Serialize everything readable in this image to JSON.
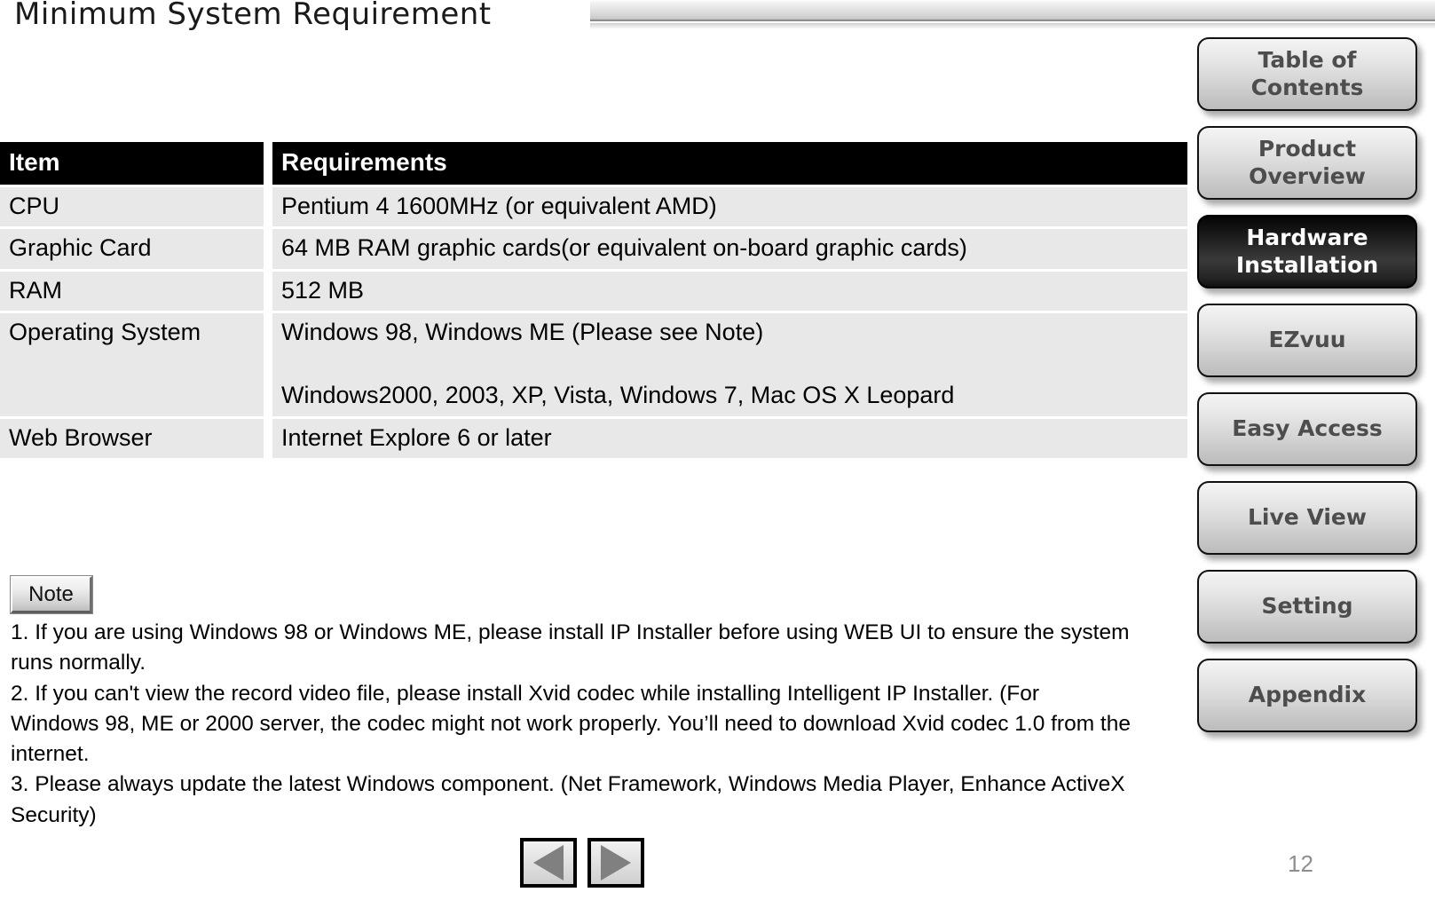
{
  "page_title": "Minimum System Requirement",
  "table": {
    "headers": [
      "Item",
      "Requirements"
    ],
    "rows": [
      {
        "item": "CPU",
        "requirement": "Pentium 4 1600MHz (or equivalent AMD)",
        "requirement2": ""
      },
      {
        "item": "Graphic Card",
        "requirement": "64 MB RAM graphic cards(or equivalent on-board graphic cards)",
        "requirement2": ""
      },
      {
        "item": "RAM",
        "requirement": "512 MB",
        "requirement2": ""
      },
      {
        "item": "Operating System",
        "requirement": "Windows 98, Windows ME (Please see Note)",
        "requirement2": "Windows2000, 2003, XP, Vista, Windows 7, Mac OS X Leopard"
      },
      {
        "item": "Web Browser",
        "requirement": "Internet Explore 6 or later",
        "requirement2": ""
      }
    ]
  },
  "note": {
    "badge_label": "Note",
    "items": [
      "1. If you are using Windows 98 or Windows ME, please install IP Installer before using WEB UI to ensure the system runs normally.",
      "2. If you can't view the record video file, please install Xvid codec while installing Intelligent IP Installer. (For Windows 98, ME or 2000 server, the codec might not work properly. You’ll need to download Xvid codec 1.0 from the internet.",
      "3. Please always update the latest Windows component. (Net Framework, Windows Media Player, Enhance ActiveX Security)"
    ]
  },
  "navigation": {
    "prev_label": "◀",
    "next_label": "▶",
    "prev_icon": "triangle-left-icon",
    "next_icon": "triangle-right-icon"
  },
  "sidebar": {
    "items": [
      {
        "label": "Table of Contents",
        "active": false
      },
      {
        "label": "Product Overview",
        "active": false
      },
      {
        "label": "Hardware Installation",
        "active": true
      },
      {
        "label": "EZvuu",
        "active": false
      },
      {
        "label": "Easy Access",
        "active": false
      },
      {
        "label": "Live View",
        "active": false
      },
      {
        "label": "Setting",
        "active": false
      },
      {
        "label": "Appendix",
        "active": false
      }
    ]
  },
  "page_number": "12",
  "colors": {
    "header_bg": "#000000",
    "header_text": "#ffffff",
    "row_bg": "#e8e8e8",
    "sidebar_text": "#4d4d4d",
    "sidebar_active_text": "#ffffff",
    "page_number_color": "#8e8e8e"
  }
}
